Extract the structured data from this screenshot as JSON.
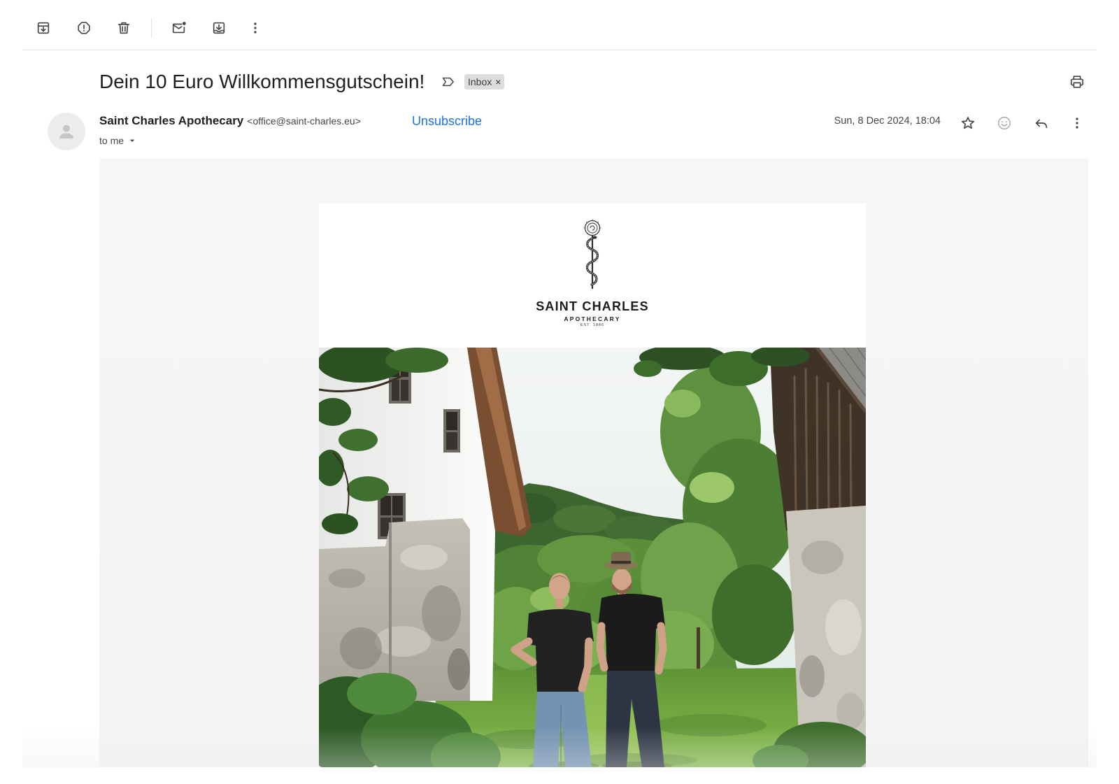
{
  "toolbar": {
    "archive_icon": "archive-icon",
    "spam_icon": "report-spam-icon",
    "delete_icon": "delete-icon",
    "unread_icon": "mark-unread-icon",
    "move_icon": "move-to-icon",
    "more_icon": "more-vert-icon"
  },
  "header": {
    "subject": "Dein 10 Euro Willkommensgutschein!",
    "importance_icon": "label-important-icon",
    "label": "Inbox",
    "label_remove": "×",
    "print_icon": "print-icon"
  },
  "message": {
    "avatar_icon": "person-icon",
    "sender_name": "Saint Charles Apothecary",
    "sender_email": "<office@saint-charles.eu>",
    "unsubscribe": "Unsubscribe",
    "recipient": "to me",
    "recipient_caret_icon": "caret-down-icon",
    "date": "Sun, 8 Dec 2024, 18:04",
    "star_icon": "star-icon",
    "emoji_icon": "add-reaction-icon",
    "reply_icon": "reply-icon",
    "more_icon": "more-vert-icon"
  },
  "newsletter": {
    "logo_icon": "rod-of-asclepius-icon",
    "brand": "SAINT CHARLES",
    "brand_sub": "APOTHECARY",
    "established": "EST. 1886"
  },
  "colors": {
    "text": "#1f1f1f",
    "muted": "#444746",
    "link": "#1a73e8",
    "chip_bg": "#dddddd",
    "body_bg": "#f5f5f5",
    "card_bg": "#ffffff"
  }
}
